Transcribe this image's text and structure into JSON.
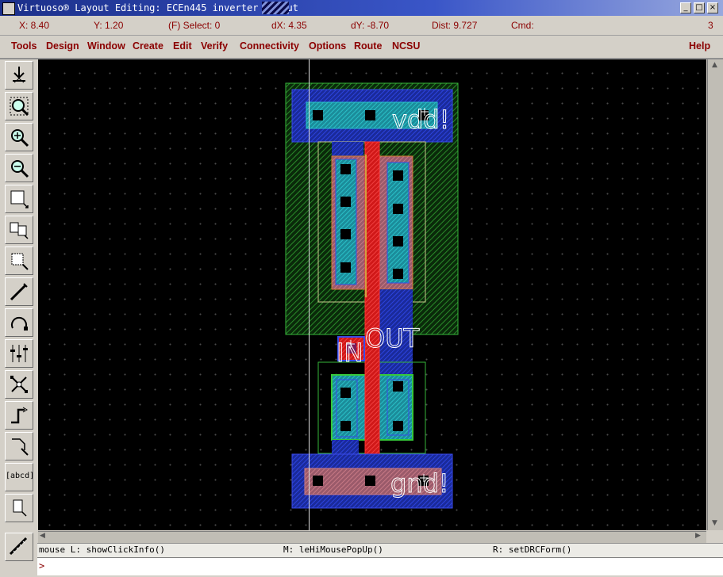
{
  "window": {
    "title": "Virtuoso® Layout Editing: ECEn445 inverter layout",
    "minimize": "_",
    "maximize": "□",
    "close": "×"
  },
  "status": {
    "x": "X: 8.40",
    "y": "Y: 1.20",
    "select": "(F) Select: 0",
    "dx": "dX: 4.35",
    "dy": "dY: -8.70",
    "dist": "Dist: 9.727",
    "cmd": "Cmd:",
    "count": "3"
  },
  "menu": {
    "tools": "Tools",
    "design": "Design",
    "window": "Window",
    "create": "Create",
    "edit": "Edit",
    "verify": "Verify",
    "connectivity": "Connectivity",
    "options": "Options",
    "route": "Route",
    "ncsu": "NCSU",
    "help": "Help"
  },
  "tools": [
    {
      "icon": "save-icon"
    },
    {
      "icon": "fit-zoom-icon"
    },
    {
      "icon": "zoom-in-icon"
    },
    {
      "icon": "zoom-out-icon"
    },
    {
      "icon": "stretch-icon"
    },
    {
      "icon": "copy-icon"
    },
    {
      "icon": "move-icon"
    },
    {
      "icon": "path-icon"
    },
    {
      "icon": "undo-icon"
    },
    {
      "icon": "properties-icon"
    },
    {
      "icon": "hierarchy-icon"
    },
    {
      "icon": "wire-icon"
    },
    {
      "icon": "select-icon"
    },
    {
      "icon": "label-icon",
      "label": "[abcd]"
    },
    {
      "icon": "rectangle-icon"
    },
    {
      "icon": "ruler-icon"
    }
  ],
  "layout": {
    "labels": {
      "vdd": "vdd!",
      "in": "IN",
      "out": "OUT",
      "gnd": "gnd!"
    },
    "colors": {
      "nwell": "#1f8a2a",
      "metal1": "#1f2fc8",
      "active": "#1faaaa",
      "poly": "#e02020",
      "select": "#c8c88c",
      "contact": "#000000",
      "label": "#ffffff"
    }
  },
  "mouse": {
    "left": "mouse L: showClickInfo()",
    "middle": "M: leHiMousePopUp()",
    "right": "R: setDRCForm()"
  },
  "cmdline": {
    "prompt": ">"
  }
}
